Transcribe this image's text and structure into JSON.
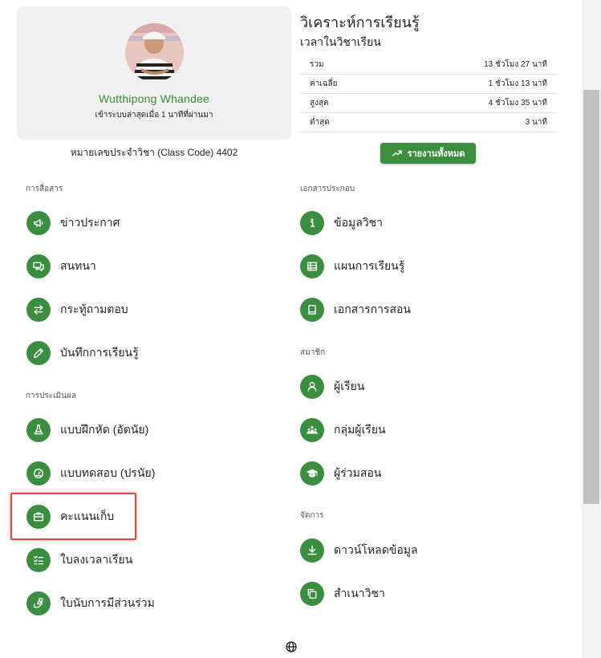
{
  "profile": {
    "name": "Wutthipong Whandee",
    "last_login": "เข้าระบบล่าสุดเมื่อ 1 นาทีที่ผ่านมา",
    "class_code": "หมายเลขประจำวิชา (Class Code) 4402"
  },
  "analytics": {
    "title": "วิเคราะห์การเรียนรู้",
    "subtitle": "เวลาในวิชาเรียน",
    "rows": [
      {
        "label": "รวม",
        "value": "13 ชั่วโมง 27 นาที"
      },
      {
        "label": "ค่าเฉลี่ย",
        "value": "1 ชั่วโมง 13 นาที"
      },
      {
        "label": "สูงสุด",
        "value": "4 ชั่วโมง 35 นาที"
      },
      {
        "label": "ต่ำสุด",
        "value": "3 นาที"
      }
    ],
    "report_button": "รายงานทั้งหมด"
  },
  "sections": {
    "communication": "การสื่อสาร",
    "assessment": "การประเมินผล",
    "documents": "เอกสารประกอบ",
    "members": "สมาชิก",
    "manage": "จัดการ"
  },
  "menu": {
    "news": "ข่าวประกาศ",
    "chat": "สนทนา",
    "qa": "กระทู้ถามตอบ",
    "journal": "บันทึกการเรียนรู้",
    "exercise": "แบบฝึกหัด (อัตนัย)",
    "test": "แบบทดสอบ (ปรนัย)",
    "scores": "คะแนนเก็บ",
    "attendance": "ใบลงเวลาเรียน",
    "participation": "ใบนับการมีส่วนร่วม",
    "course_info": "ข้อมูลวิชา",
    "plan": "แผนการเรียนรู้",
    "teaching_docs": "เอกสารการสอน",
    "students": "ผู้เรียน",
    "groups": "กลุ่มผู้เรียน",
    "co_teachers": "ผู้ร่วมสอน",
    "download": "ดาวน์โหลดข้อมูล",
    "copy": "สำเนาวิชา"
  },
  "colors": {
    "accent": "#3b8d3f",
    "name": "#3a8a3a",
    "highlight": "#e04848"
  },
  "icons": {
    "news": "megaphone-icon",
    "chat": "chat-icon",
    "qa": "swap-icon",
    "journal": "pencil-icon",
    "exercise": "flask-icon",
    "test": "gauge-icon",
    "scores": "briefcase-icon",
    "attendance": "checklist-icon",
    "participation": "hand-icon",
    "course_info": "info-icon",
    "plan": "table-icon",
    "teaching_docs": "book-icon",
    "students": "person-icon",
    "groups": "group-icon",
    "co_teachers": "graduation-cap-icon",
    "download": "download-icon",
    "copy": "copy-icon",
    "footer": "globe-icon",
    "report": "trending-up-icon"
  }
}
